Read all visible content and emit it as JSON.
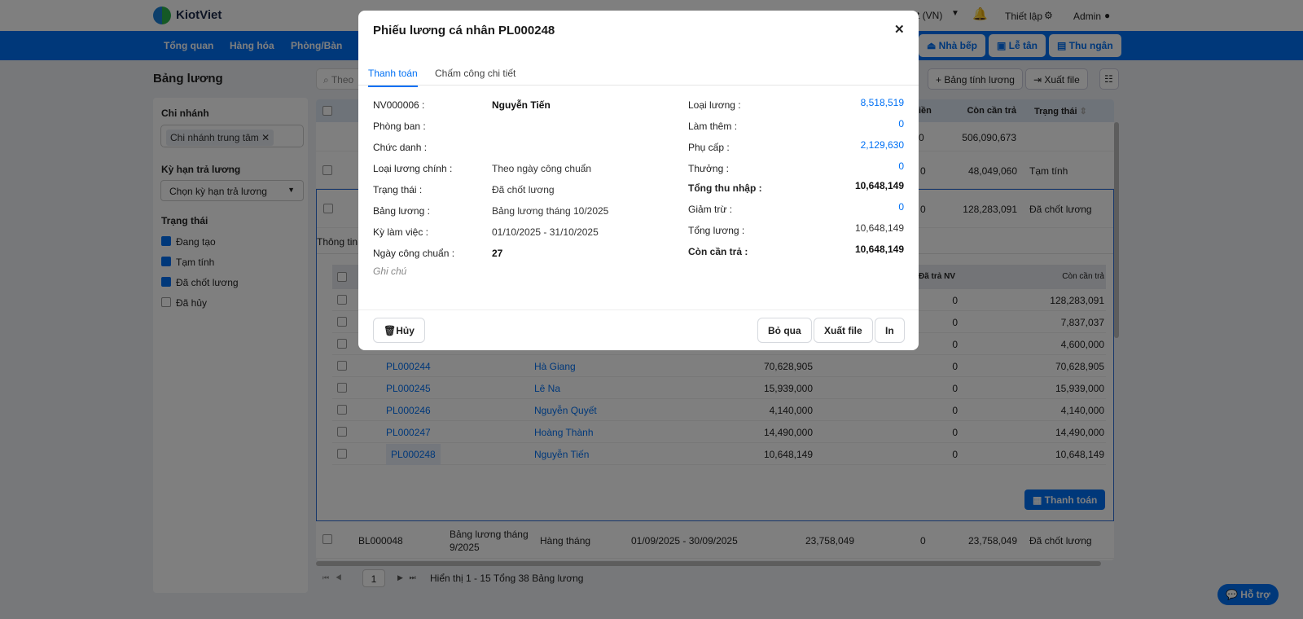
{
  "app": {
    "brand": "KiotViet",
    "lang": "t (VN)",
    "settings": "Thiết lập",
    "user": "Admin"
  },
  "nav": {
    "items": [
      "Tổng quan",
      "Hàng hóa",
      "Phòng/Bàn"
    ],
    "kitchen": "Nhà bếp",
    "reception": "Lễ tân",
    "cashier": "Thu ngân"
  },
  "page": {
    "title": "Bảng lương",
    "search_placeholder": "Theo",
    "add_btn": "Bảng tính lương",
    "export_btn": "Xuất file"
  },
  "filters": {
    "branch_label": "Chi nhánh",
    "branch_tag": "Chi nhánh trung tâm",
    "period_label": "Kỳ hạn trả lương",
    "period_placeholder": "Chọn kỳ hạn trả lương",
    "status_label": "Trạng thái",
    "statuses": [
      {
        "label": "Đang tạo",
        "checked": true
      },
      {
        "label": "Tạm tính",
        "checked": true
      },
      {
        "label": "Đã chốt lương",
        "checked": true
      },
      {
        "label": "Đã hủy",
        "checked": false
      }
    ]
  },
  "table": {
    "headers": {
      "paid": "iền",
      "remaining": "Còn cần trả",
      "status": "Trạng thái"
    },
    "summary": {
      "paid": "0",
      "remaining": "506,090,673"
    },
    "rows": [
      {
        "paid": "0",
        "remaining": "48,049,060",
        "status": "Tạm tính"
      },
      {
        "paid": "0",
        "remaining": "128,283,091",
        "status": "Đã chốt lương"
      }
    ],
    "last_row": {
      "code": "BL000048",
      "name": "Bảng lương tháng 9/2025",
      "term": "Hàng tháng",
      "period": "01/09/2025 - 30/09/2025",
      "total": "23,758,049",
      "paid": "0",
      "remaining": "23,758,049",
      "status": "Đã chốt lương"
    }
  },
  "detail": {
    "tab": "Thông tin",
    "headers": {
      "paid": "Đã trả NV",
      "remaining": "Còn cần trả"
    },
    "rows": [
      {
        "code": "",
        "name": "",
        "total": "",
        "paid": "0",
        "remaining": "128,283,091"
      },
      {
        "code": "",
        "name": "",
        "total": "",
        "paid": "0",
        "remaining": "7,837,037"
      },
      {
        "code": "",
        "name": "",
        "total": "",
        "paid": "0",
        "remaining": "4,600,000"
      },
      {
        "code": "PL000244",
        "name": "Hà Giang",
        "total": "70,628,905",
        "paid": "0",
        "remaining": "70,628,905"
      },
      {
        "code": "PL000245",
        "name": "Lê Na",
        "total": "15,939,000",
        "paid": "0",
        "remaining": "15,939,000"
      },
      {
        "code": "PL000246",
        "name": "Nguyễn Quyết",
        "total": "4,140,000",
        "paid": "0",
        "remaining": "4,140,000"
      },
      {
        "code": "PL000247",
        "name": "Hoàng Thành",
        "total": "14,490,000",
        "paid": "0",
        "remaining": "14,490,000"
      },
      {
        "code": "PL000248",
        "name": "Nguyễn Tiến",
        "total": "10,648,149",
        "paid": "0",
        "remaining": "10,648,149"
      }
    ],
    "pay_btn": "Thanh toán"
  },
  "pagination": {
    "page": "1",
    "info": "Hiển thị 1 - 15 Tổng 38 Bảng lương"
  },
  "help": "Hỗ trợ",
  "modal": {
    "title": "Phiếu lương cá nhân PL000248",
    "tabs": [
      "Thanh toán",
      "Chấm công chi tiết"
    ],
    "left": [
      {
        "label": "NV000006 :",
        "value": "Nguyễn Tiến",
        "bold": true
      },
      {
        "label": "Phòng ban :",
        "value": ""
      },
      {
        "label": "Chức danh :",
        "value": ""
      },
      {
        "label": "Loại lương chính :",
        "value": "Theo ngày công chuẩn"
      },
      {
        "label": "Trạng thái :",
        "value": "Đã chốt lương"
      },
      {
        "label": "Bảng lương :",
        "value": "Bảng lương tháng 10/2025"
      },
      {
        "label": "Kỳ làm việc :",
        "value": "01/10/2025 - 31/10/2025"
      },
      {
        "label": "Ngày công chuẩn :",
        "value": "27",
        "bold": true
      }
    ],
    "note": "Ghi chú",
    "right": [
      {
        "label": "Loại lương :",
        "value": "8,518,519",
        "link": true
      },
      {
        "label": "Làm thêm :",
        "value": "0",
        "link": true
      },
      {
        "label": "Phụ cấp :",
        "value": "2,129,630",
        "link": true
      },
      {
        "label": "Thưởng :",
        "value": "0",
        "link": true
      },
      {
        "label": "Tổng thu nhập :",
        "value": "10,648,149",
        "bold": true
      },
      {
        "label": "Giảm trừ :",
        "value": "0",
        "link": true
      },
      {
        "label": "Tổng lương :",
        "value": "10,648,149"
      },
      {
        "label": "Còn cần trả :",
        "value": "10,648,149",
        "bold": true
      }
    ],
    "cancel": "Hủy",
    "skip": "Bỏ qua",
    "export": "Xuất file",
    "print": "In"
  },
  "colors": {
    "accent": "#0070f4"
  }
}
